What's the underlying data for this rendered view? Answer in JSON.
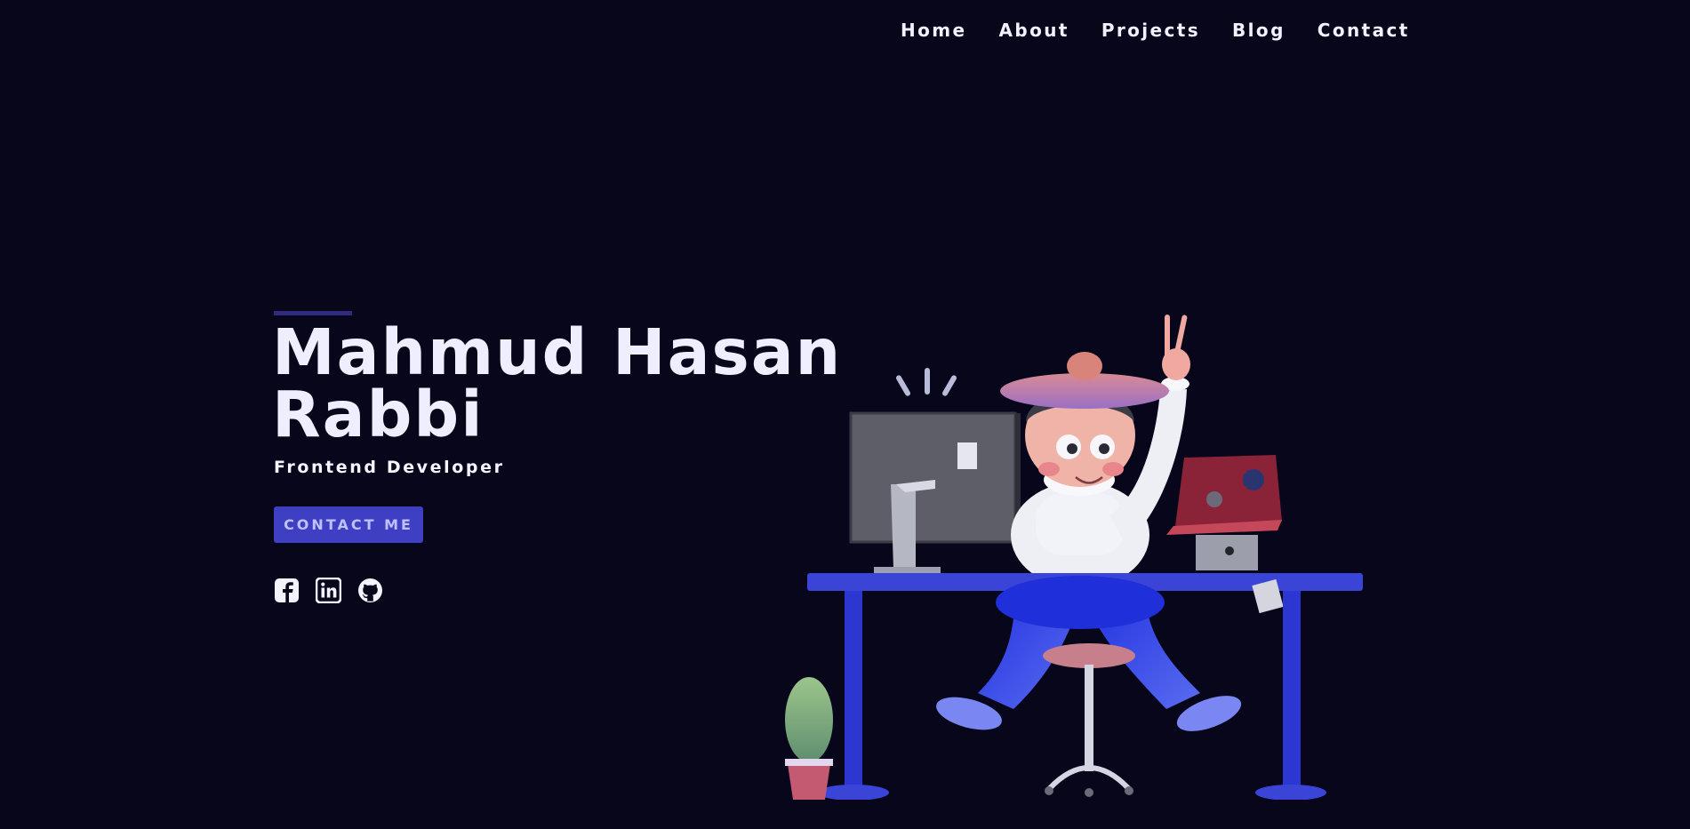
{
  "nav": {
    "items": [
      {
        "label": "Home"
      },
      {
        "label": "About"
      },
      {
        "label": "Projects"
      },
      {
        "label": "Blog"
      },
      {
        "label": "Contact"
      }
    ]
  },
  "hero": {
    "name": "Mahmud Hasan Rabbi",
    "role": "Frontend Developer",
    "cta_label": "CONTACT ME"
  },
  "social": {
    "icons": [
      "facebook-icon",
      "linkedin-icon",
      "github-icon"
    ]
  },
  "colors": {
    "background": "#07061a",
    "accent": "#3e3fc2",
    "desk": "#3a45d8"
  }
}
